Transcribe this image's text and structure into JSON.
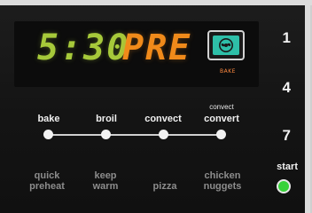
{
  "display": {
    "time": "5:30",
    "mode": "PRE",
    "bake_indicator_label": "BAKE",
    "icon": "fan-bake-icon"
  },
  "keypad": {
    "numbers": [
      "1",
      "4",
      "7"
    ],
    "start_label": "start",
    "start_indicator_color": "#38d23a"
  },
  "modes": [
    {
      "label": "bake"
    },
    {
      "label": "broil"
    },
    {
      "label": "convect"
    },
    {
      "label": "convert",
      "sub": "convect"
    }
  ],
  "quick_buttons": [
    {
      "label": "quick\npreheat"
    },
    {
      "label": "keep\nwarm"
    },
    {
      "label": "pizza"
    },
    {
      "label": "chicken\nnuggets"
    }
  ],
  "colors": {
    "time": "#a6c93a",
    "pre": "#f08a1a",
    "icon_bg": "#2ebfa8"
  }
}
